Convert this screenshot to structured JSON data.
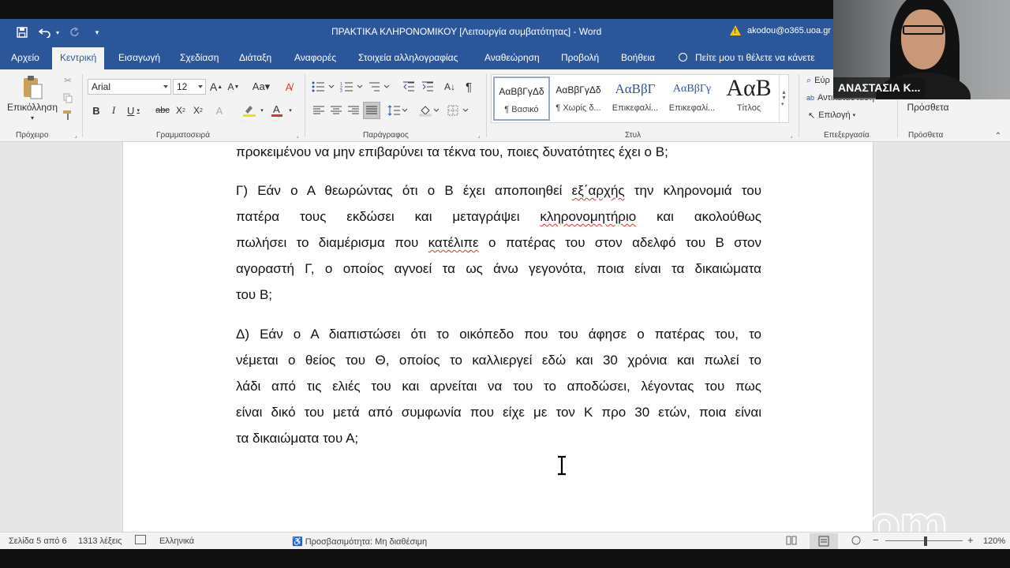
{
  "window": {
    "title": "ΠΡΑΚΤΙΚΑ ΚΛΗΡΟΝΟΜΙΚΟΥ [Λειτουργία συμβατότητας]  -  Word",
    "account": "akodou@o365.uoa.gr"
  },
  "tabs": [
    "Αρχείο",
    "Κεντρική",
    "Εισαγωγή",
    "Σχεδίαση",
    "Διάταξη",
    "Αναφορές",
    "Στοιχεία αλληλογραφίας",
    "Αναθεώρηση",
    "Προβολή",
    "Βοήθεια"
  ],
  "active_tab": "Κεντρική",
  "tell_me": "Πείτε μου τι θέλετε να κάνετε",
  "ribbon": {
    "paste_label": "Επικόλληση",
    "font_name": "Arial",
    "font_size": "12",
    "styles": [
      {
        "sample": "ΑαΒβΓγΔδ",
        "name": "¶ Βασικό"
      },
      {
        "sample": "ΑαΒβΓγΔδ",
        "name": "¶ Χωρίς δ..."
      },
      {
        "sample": "ΑαΒβΓ",
        "name": "Επικεφαλί..."
      },
      {
        "sample": "ΑαΒβΓγ",
        "name": "Επικεφαλί..."
      },
      {
        "sample": "ΑαΒ",
        "name": "Τίτλος"
      }
    ],
    "find_label": "Εύρ",
    "replace_label": "Αντικατάσταση",
    "select_label": "Επιλογή",
    "addins_label": "Πρόσθετα",
    "groups": {
      "clipboard": "Πρόχειρο",
      "font": "Γραμματοσειρά",
      "paragraph": "Παράγραφος",
      "styles": "Στυλ",
      "editing": "Επεξεργασία",
      "addins": "Πρόσθετα"
    }
  },
  "document": {
    "p0": "προκειμένου να μην επιβαρύνει τα τέκνα του, ποιες δυνατότητες έχει ο Β;",
    "p1": {
      "l1a": "Γ) Εάν ο Α θεωρώντας ότι ο Β έχει αποποιηθεί ",
      "l1b": "εξ΄αρχής",
      "l1c": " την κληρονομιά του",
      "l2a": "πατέρα τους εκδώσει και μεταγράψει ",
      "l2b": "κληρονομητήριο",
      "l2c": " και ακολούθως",
      "l3a": "πωλήσει το διαμέρισμα που ",
      "l3b": "κατέλιπε",
      "l3c": " ο πατέρας του στον αδελφό του Β στον",
      "l4": "αγοραστή Γ, ο οποίος αγνοεί τα ως άνω γεγονότα, ποια είναι τα δικαιώματα",
      "l5": "του Β;"
    },
    "p2": {
      "l1": "Δ) Εάν ο Α διαπιστώσει ότι το οικόπεδο που του άφησε ο πατέρας του, το",
      "l2": "νέμεται ο θείος του Θ, οποίος το καλλιεργεί εδώ και 30 χρόνια και πωλεί το",
      "l3": "λάδι από τις ελιές του και αρνείται να του το αποδώσει, λέγοντας του πως",
      "l4": "είναι δικό του μετά από συμφωνία που είχε με τον Κ προ 30 ετών, ποια είναι",
      "l5": "τα δικαιώματα του Α;"
    }
  },
  "status": {
    "page": "Σελίδα 5 από 6",
    "words": "1313 λέξεις",
    "language": "Ελληνικά",
    "accessibility": "Προσβασιμότητα: Μη διαθέσιμη",
    "zoom": "120%"
  },
  "video": {
    "participant": "ΑΝΑΣΤΑΣΙΑ Κ..."
  },
  "watermark": "zoom"
}
